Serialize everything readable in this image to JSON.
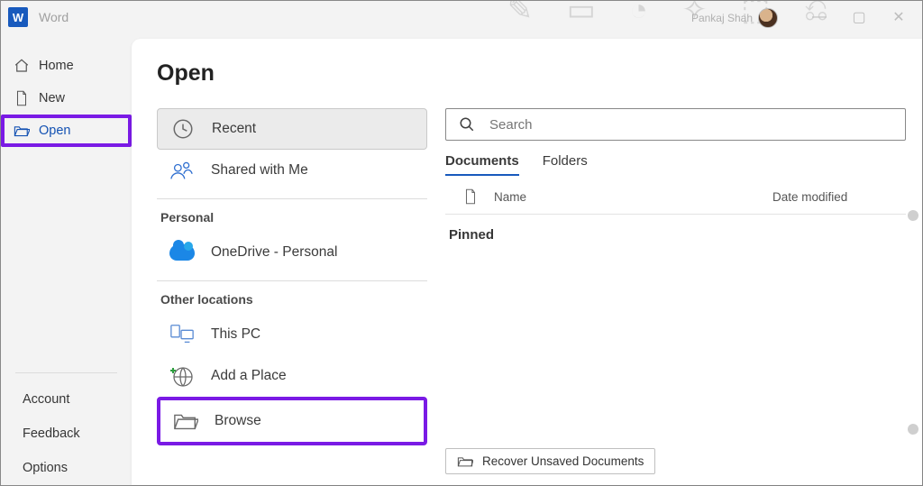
{
  "app": {
    "name": "Word",
    "user_name": "Pankaj Shah"
  },
  "window_controls": {
    "min": "—",
    "max": "▢",
    "close": "✕"
  },
  "nav": {
    "home": "Home",
    "new": "New",
    "open": "Open",
    "account": "Account",
    "feedback": "Feedback",
    "options": "Options"
  },
  "page": {
    "title": "Open"
  },
  "sources": {
    "recent": "Recent",
    "shared": "Shared with Me",
    "personal_heading": "Personal",
    "onedrive": "OneDrive - Personal",
    "other_heading": "Other locations",
    "thispc": "This PC",
    "addplace": "Add a Place",
    "browse": "Browse"
  },
  "search": {
    "placeholder": "Search"
  },
  "tabs": {
    "documents": "Documents",
    "folders": "Folders"
  },
  "list": {
    "col_name": "Name",
    "col_date": "Date modified",
    "section_pinned": "Pinned"
  },
  "footer": {
    "recover": "Recover Unsaved Documents"
  }
}
